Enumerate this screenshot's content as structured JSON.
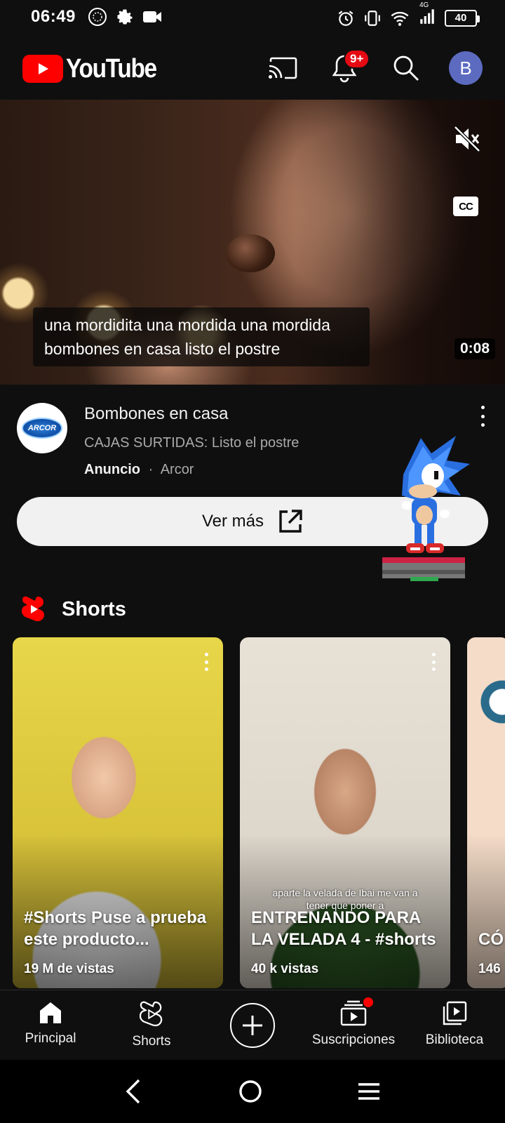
{
  "status_bar": {
    "time": "06:49",
    "network": "4G",
    "battery": "40"
  },
  "appbar": {
    "brand": "YouTube",
    "notification_badge": "9+",
    "avatar_letter": "B",
    "icons": [
      "cast-icon",
      "bell-icon",
      "search-icon"
    ]
  },
  "ad": {
    "caption_line1": "una mordidita una mordida una mordida",
    "caption_line2": "bombones en casa listo el postre",
    "duration": "0:08",
    "cc_label": "CC",
    "title": "Bombones en casa",
    "subtitle": "CAJAS SURTIDAS: Listo el postre",
    "sponsored_label": "Anuncio",
    "separator": "·",
    "advertiser": "Arcor",
    "advertiser_logo_text": "ARCOR",
    "cta_label": "Ver más"
  },
  "shorts": {
    "section_title": "Shorts",
    "items": [
      {
        "title": "#Shorts Puse a prueba este producto...",
        "views": "19 M de vistas",
        "burned_caption": ""
      },
      {
        "title": "ENTRENANDO PARA LA VELADA 4 - #shorts",
        "views": "40 k vistas",
        "burned_caption": "aparte la velada de Ibai me van a tener que poner a"
      },
      {
        "title": "CÓ EL I",
        "views": "146",
        "burned_caption": ""
      }
    ]
  },
  "bottom_nav": {
    "items": [
      {
        "label": "Principal",
        "icon": "home-icon"
      },
      {
        "label": "Shorts",
        "icon": "shorts-icon"
      },
      {
        "label": "",
        "icon": "create-icon"
      },
      {
        "label": "Suscripciones",
        "icon": "subscriptions-icon"
      },
      {
        "label": "Biblioteca",
        "icon": "library-icon"
      }
    ]
  },
  "colors": {
    "background": "#0f0f0f",
    "brand_red": "#ff0000",
    "avatar": "#5c6bc0",
    "cta_background": "#f1f1f1",
    "secondary_text": "#aaaaaa"
  }
}
